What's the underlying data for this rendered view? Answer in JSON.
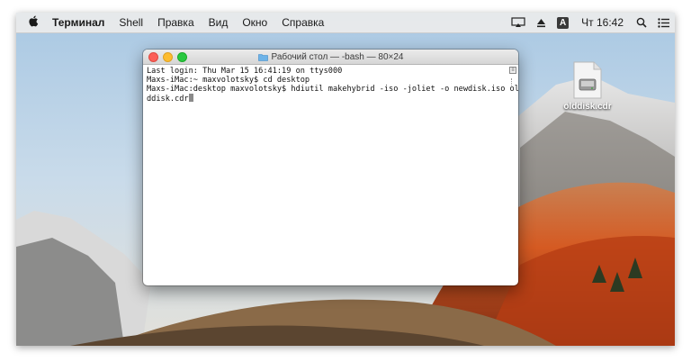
{
  "menubar": {
    "apple_glyph": "",
    "app_name": "Терминал",
    "items": [
      "Shell",
      "Правка",
      "Вид",
      "Окно",
      "Справка"
    ],
    "input_source": "A",
    "clock": "Чт 16:42",
    "icons": [
      "airplay-icon",
      "eject-icon",
      "input-source-icon",
      "search-icon",
      "notification-center-icon"
    ]
  },
  "window": {
    "title": "Рабочий стол — -bash — 80×24",
    "lines": [
      "Last login: Thu Mar 15 16:41:19 on ttys000",
      "Maxs-iMac:~ maxvolotsky$ cd desktop",
      "Maxs-iMac:desktop maxvolotsky$ hdiutil makehybrid -iso -joliet -o newdisk.iso ol",
      "ddisk.cdr"
    ]
  },
  "desktop": {
    "file_label": "olddisk.cdr"
  }
}
